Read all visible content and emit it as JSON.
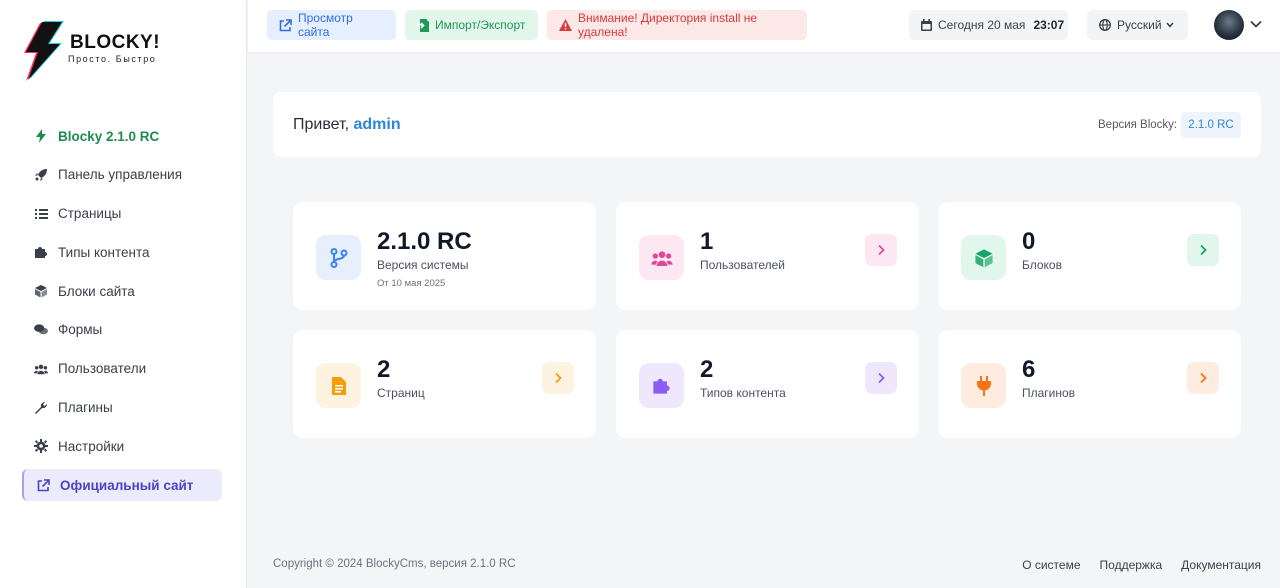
{
  "brand": {
    "title": "BLOCKY!",
    "subtitle": "Просто. Быстро"
  },
  "sidebar": {
    "items": [
      {
        "label": "Blocky 2.1.0 RC",
        "icon": "bolt-icon"
      },
      {
        "label": "Панель управления",
        "icon": "rocket-icon"
      },
      {
        "label": "Страницы",
        "icon": "list-icon"
      },
      {
        "label": "Типы контента",
        "icon": "puzzle-icon"
      },
      {
        "label": "Блоки сайта",
        "icon": "cube-icon"
      },
      {
        "label": "Формы",
        "icon": "comments-icon"
      },
      {
        "label": "Пользователи",
        "icon": "users-icon"
      },
      {
        "label": "Плагины",
        "icon": "wrench-icon"
      },
      {
        "label": "Настройки",
        "icon": "gear-icon"
      },
      {
        "label": "Официальный сайт",
        "icon": "external-link-icon"
      }
    ]
  },
  "topbar": {
    "view_site": "Просмотр сайта",
    "import_export": "Импорт/Экспорт",
    "warning": "Внимание! Директория install не удалена!",
    "date": "Сегодня 20 мая",
    "time": "23:07",
    "language": "Русский"
  },
  "greeting": {
    "hello": "Привет,",
    "user": "admin",
    "version_label": "Версия Blocky:",
    "version": "2.1.0 RC"
  },
  "stats": [
    {
      "value": "2.1.0 RC",
      "label": "Версия системы",
      "date": "От 10 мая 2025",
      "icon": "branch-icon",
      "color": "#3b82f6",
      "bg": "#e7effd"
    },
    {
      "value": "1",
      "label": "Пользователей",
      "icon": "users-icon",
      "color": "#e0479a",
      "bg": "#fde7f2"
    },
    {
      "value": "0",
      "label": "Блоков",
      "icon": "cube-icon",
      "color": "#16a36a",
      "bg": "#e1f6ec"
    },
    {
      "value": "2",
      "label": "Страниц",
      "icon": "file-icon",
      "color": "#f59e0b",
      "bg": "#fef3e0"
    },
    {
      "value": "2",
      "label": "Типов контента",
      "icon": "puzzle-icon",
      "color": "#8b5cf6",
      "bg": "#efe8fd"
    },
    {
      "value": "6",
      "label": "Плагинов",
      "icon": "plug-icon",
      "color": "#f97316",
      "bg": "#feece0"
    }
  ],
  "footer": {
    "copyright": "Copyright © 2024 BlockyCms, версия 2.1.0 RC",
    "links": [
      "О системе",
      "Поддержка",
      "Документация"
    ]
  }
}
